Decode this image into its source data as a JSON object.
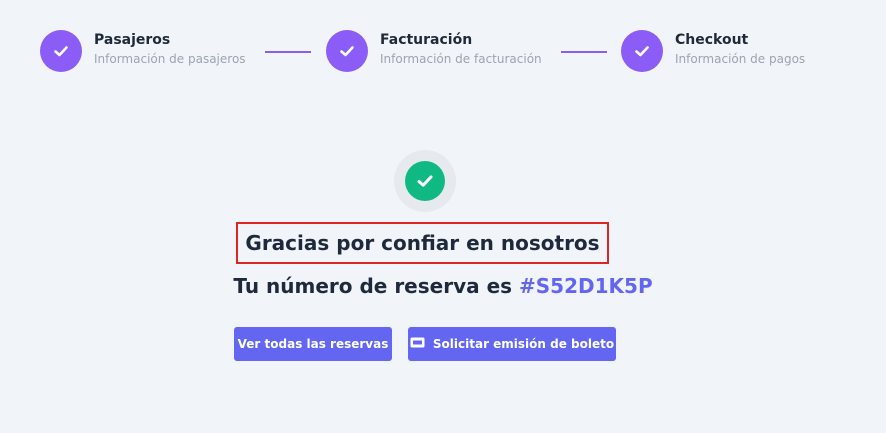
{
  "stepper": {
    "steps": [
      {
        "title": "Pasajeros",
        "subtitle": "Información de pasajeros",
        "state": "complete"
      },
      {
        "title": "Facturación",
        "subtitle": "Información de facturación",
        "state": "complete"
      },
      {
        "title": "Checkout",
        "subtitle": "Información de pagos",
        "state": "complete"
      }
    ]
  },
  "confirmation": {
    "thanks": "Gracias por confiar en nosotros",
    "reservation_prefix": "Tu número de reserva es",
    "reservation_code": "#S52D1K5P"
  },
  "actions": {
    "view_all_label": "Ver todas las reservas",
    "request_ticket_label": "Solicitar emisión de boleto"
  },
  "colors": {
    "accent": "#8b5cf6",
    "primary_button": "#6366f1",
    "success": "#10b981",
    "highlight_border": "#dc2626",
    "background": "#f1f5f9"
  },
  "icons": {
    "step_check": "check-icon",
    "success": "check-circle-icon",
    "ticket": "ticket-icon"
  }
}
